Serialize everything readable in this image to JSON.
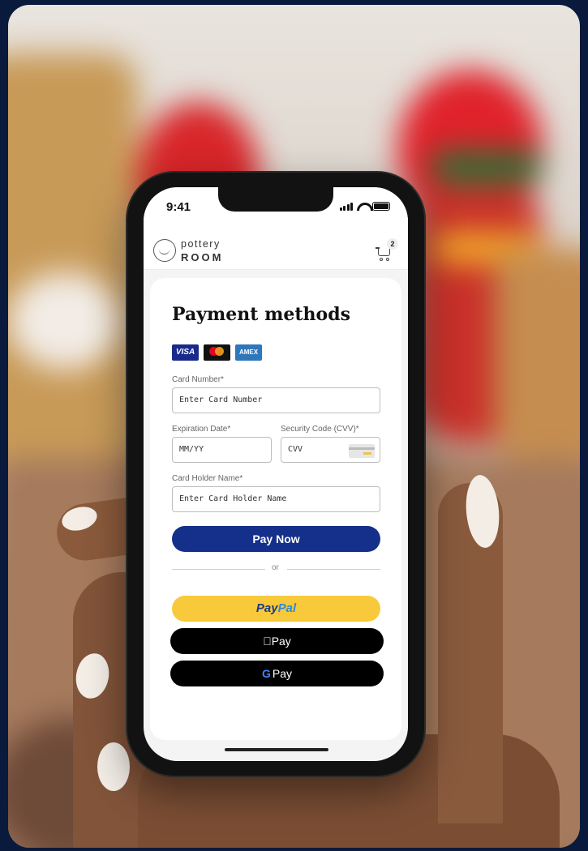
{
  "status_bar": {
    "time": "9:41"
  },
  "brand": {
    "top": "pottery",
    "bottom": "ROOM"
  },
  "cart": {
    "count": "2"
  },
  "payment": {
    "title": "Payment methods",
    "card_logos": [
      "VISA",
      "MasterCard",
      "AMEX"
    ],
    "card_number": {
      "label": "Card Number*",
      "placeholder": "Enter Card Number"
    },
    "expiration": {
      "label": "Expiration Date*",
      "placeholder": "MM/YY"
    },
    "cvv": {
      "label": "Security Code (CVV)*",
      "placeholder": "CVV"
    },
    "holder": {
      "label": "Card Holder Name*",
      "placeholder": "Enter Card Holder Name"
    },
    "pay_now": "Pay Now",
    "or": "or",
    "paypal_part1": "Pay",
    "paypal_part2": "Pal",
    "apple_pay": "Pay",
    "google_g": "G",
    "google_pay": "Pay"
  },
  "colors": {
    "pay_now": "#15308a",
    "paypal": "#f8c93a",
    "wallet_buttons": "#000000",
    "page_background": "#0a1a3c"
  }
}
